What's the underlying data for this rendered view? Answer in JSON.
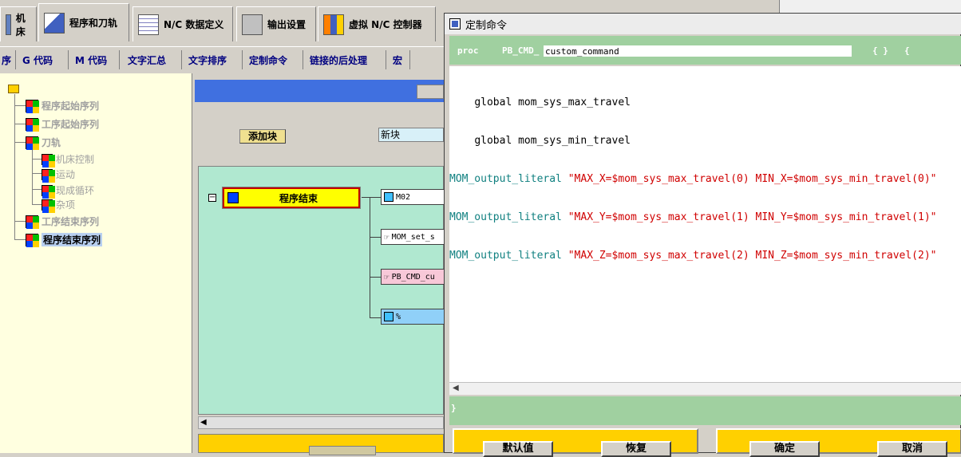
{
  "top_tabs": [
    {
      "label": "机床"
    },
    {
      "label": "程序和刀轨"
    },
    {
      "label": "N/C 数据定义"
    },
    {
      "label": "输出设置"
    },
    {
      "label": "虚拟 N/C 控制器"
    }
  ],
  "sub_tabs": [
    {
      "label": "序"
    },
    {
      "label": "G 代码"
    },
    {
      "label": "M 代码"
    },
    {
      "label": "文字汇总"
    },
    {
      "label": "文字排序"
    },
    {
      "label": "定制命令"
    },
    {
      "label": "链接的后处理"
    },
    {
      "label": "宏"
    }
  ],
  "tree": {
    "items": [
      {
        "label": "程序起始序列"
      },
      {
        "label": "工序起始序列"
      },
      {
        "label": "刀轨"
      },
      {
        "label": "机床控制"
      },
      {
        "label": "运动"
      },
      {
        "label": "现成循环"
      },
      {
        "label": "杂项"
      },
      {
        "label": "工序结束序列"
      },
      {
        "label": "程序结束序列"
      }
    ]
  },
  "center": {
    "add_block_label": "添加块",
    "new_block_value": "新块",
    "sequence_label": "程序结束",
    "nodes": [
      {
        "label": "M02"
      },
      {
        "label": "MOM_set_s"
      },
      {
        "label": "PB_CMD_cu"
      },
      {
        "label": "%"
      }
    ]
  },
  "dialog": {
    "title": "定制命令",
    "proc_keyword": "proc",
    "cmd_prefix": "PB_CMD_",
    "cmd_name": "custom_command",
    "braces": "{ }",
    "open_brace": "{",
    "close_brace": "}",
    "code": [
      {
        "indent": "    ",
        "fn": "global",
        "args": " mom_sys_max_travel",
        "str": ""
      },
      {
        "indent": "    ",
        "fn": "global",
        "args": " mom_sys_min_travel",
        "str": ""
      },
      {
        "indent": "",
        "fn": "MOM_output_literal",
        "args": " ",
        "str": "\"MAX_X=$mom_sys_max_travel(0) MIN_X=$mom_sys_min_travel(0)\""
      },
      {
        "indent": "",
        "fn": "MOM_output_literal",
        "args": " ",
        "str": "\"MAX_Y=$mom_sys_max_travel(1) MIN_Y=$mom_sys_min_travel(1)\""
      },
      {
        "indent": "",
        "fn": "MOM_output_literal",
        "args": " ",
        "str": "\"MAX_Z=$mom_sys_max_travel(2) MIN_Z=$mom_sys_min_travel(2)\""
      }
    ],
    "buttons": {
      "default": "默认值",
      "restore": "恢复",
      "ok": "确定",
      "cancel": "取消"
    }
  },
  "colors": {
    "accent_green": "#a0d0a0",
    "button_yellow": "#ffd000",
    "code_function": "#108080",
    "code_string": "#d00000"
  }
}
